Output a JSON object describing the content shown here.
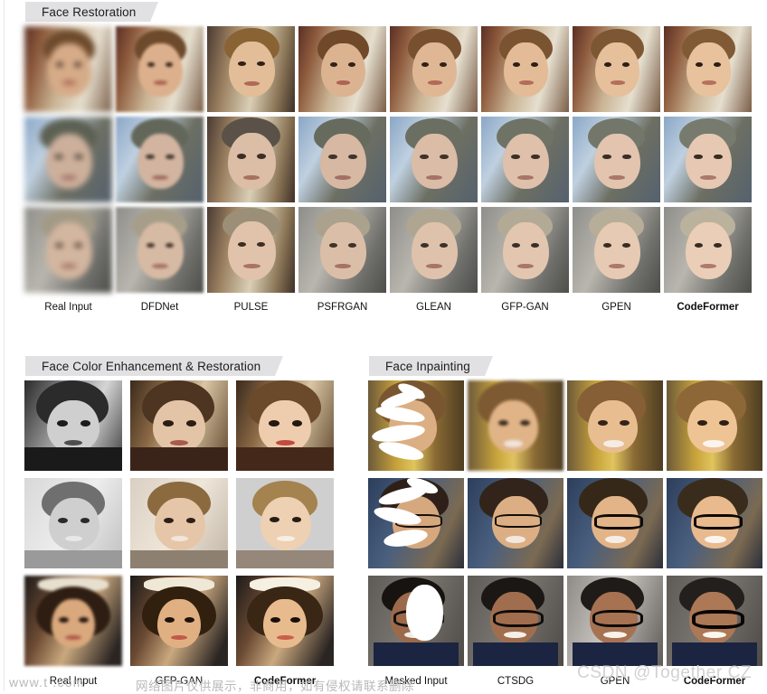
{
  "sections": [
    {
      "id": "face-restoration",
      "title": "Face Restoration",
      "columns": 8,
      "rows": 3,
      "captions": [
        "Real Input",
        "DFDNet",
        "PULSE",
        "PSFRGAN",
        "GLEAN",
        "GFP-GAN",
        "GPEN",
        "CodeFormer"
      ],
      "bold_caption": "CodeFormer",
      "row_subjects": [
        "young-man-brown-hair",
        "elderly-woman-glasses",
        "elderly-woman-smiling"
      ]
    },
    {
      "id": "face-color-enhancement",
      "title": "Face Color Enhancement & Restoration",
      "columns": 3,
      "rows": 3,
      "captions": [
        "Real Input",
        "GFP-GAN",
        "CodeFormer"
      ],
      "bold_caption": "CodeFormer",
      "row_subjects": [
        "young-child-bob-haircut",
        "young-boy-portrait",
        "young-girl-flower-crown"
      ]
    },
    {
      "id": "face-inpainting",
      "title": "Face Inpainting",
      "columns": 4,
      "rows": 3,
      "captions": [
        "Masked Input",
        "CTSDG",
        "GPEN",
        "CodeFormer"
      ],
      "bold_caption": "CodeFormer",
      "row_subjects": [
        "smiling-woman-gold-background",
        "woman-glasses-blue-top",
        "young-man-glasses-blazer"
      ]
    }
  ],
  "watermarks": {
    "url_text": "www.t          .com",
    "chinese_text": "网络图片仅供展示，非商用，如有侵权请联系删除",
    "csdn_text": "CSDN @Together CZ"
  },
  "colors": {
    "tab_background": "#e1e1e3",
    "tab_text": "#1d1d1d",
    "page_background": "#ffffff",
    "caption_text": "#101010",
    "watermark_gray": "#b9b9b9",
    "csdn_gray": "#d2d2d2"
  }
}
